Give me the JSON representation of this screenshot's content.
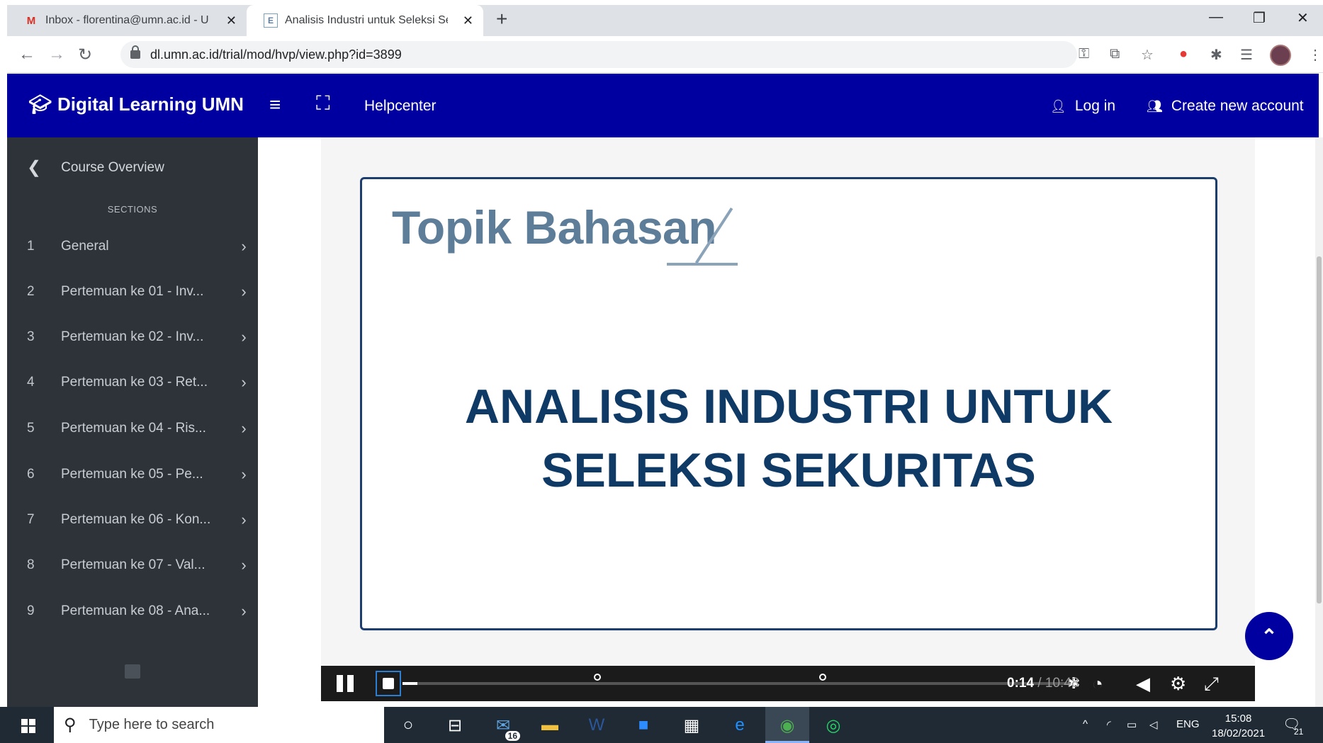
{
  "browser": {
    "tabs": [
      {
        "label": "Inbox - florentina@umn.ac.id - U",
        "favicon": "M"
      },
      {
        "label": "Analisis Industri untuk Seleksi Se",
        "favicon": "E"
      }
    ],
    "url": "dl.umn.ac.id/trial/mod/hvp/view.php?id=3899"
  },
  "header": {
    "brand": "Digital Learning UMN",
    "helpcenter": "Helpcenter",
    "login": "Log in",
    "create_account": "Create new account"
  },
  "sidebar": {
    "course_overview": "Course Overview",
    "sections_label": "SECTIONS",
    "items": [
      {
        "num": "1",
        "label": "General"
      },
      {
        "num": "2",
        "label": "Pertemuan ke 01 - Inv..."
      },
      {
        "num": "3",
        "label": "Pertemuan ke 02 - Inv..."
      },
      {
        "num": "4",
        "label": "Pertemuan ke 03 - Ret..."
      },
      {
        "num": "5",
        "label": "Pertemuan ke 04 - Ris..."
      },
      {
        "num": "6",
        "label": "Pertemuan ke 05 - Pe..."
      },
      {
        "num": "7",
        "label": "Pertemuan ke 06 - Kon..."
      },
      {
        "num": "8",
        "label": "Pertemuan ke 07 - Val..."
      },
      {
        "num": "9",
        "label": "Pertemuan ke 08 - Ana..."
      }
    ]
  },
  "slide": {
    "heading": "Topik Bahasan",
    "title_line1": "ANALISIS INDUSTRI UNTUK",
    "title_line2": "SELEKSI SEKURITAS"
  },
  "video": {
    "current_time": "0:14",
    "total_time": "10:48",
    "separator": "/",
    "progress_fraction": 0.022
  },
  "taskbar": {
    "search_placeholder": "Type here to search",
    "mail_badge": "16",
    "language": "ENG",
    "time": "15:08",
    "date": "18/02/2021",
    "notification_badge": "21"
  },
  "colors": {
    "brand_blue": "#0000a0",
    "sidebar_bg": "#2d3339",
    "slide_title": "#0f3a66",
    "slide_heading": "#5d7d98"
  }
}
